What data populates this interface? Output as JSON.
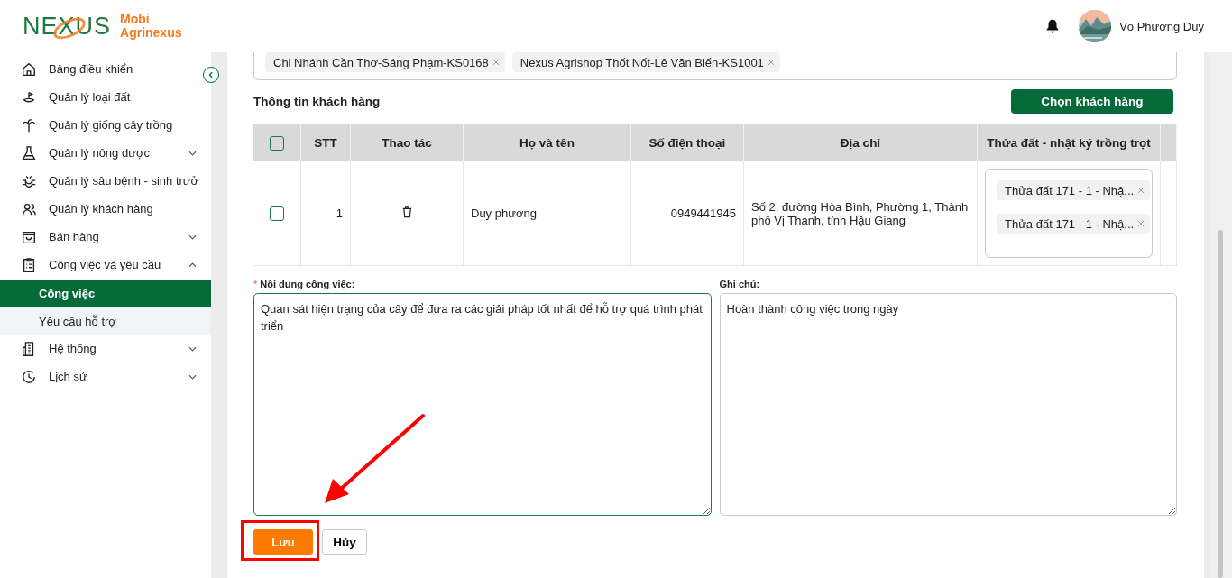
{
  "header": {
    "logo": {
      "wordmark": "NEXUS",
      "line1": "Mobi",
      "line2": "Agrinexus"
    },
    "user": {
      "name": "Võ Phương Duy"
    }
  },
  "sidebar": {
    "items": [
      {
        "label": "Bảng điều khiển"
      },
      {
        "label": "Quản lý loại đất"
      },
      {
        "label": "Quản lý giống cây trồng"
      },
      {
        "label": "Quản lý nông dược",
        "expanded": false
      },
      {
        "label": "Quản lý sâu bệnh - sinh trưở"
      },
      {
        "label": "Quản lý khách hàng"
      },
      {
        "label": "Bán hàng",
        "expanded": false
      },
      {
        "label": "Công việc và yêu cầu",
        "expanded": true,
        "children": [
          {
            "label": "Công việc",
            "selected": true
          },
          {
            "label": "Yêu cầu hỗ trợ",
            "selected": false
          }
        ]
      },
      {
        "label": "Hệ thống",
        "expanded": false
      },
      {
        "label": "Lịch sử",
        "expanded": false
      }
    ]
  },
  "stores_field": {
    "tags": [
      "Chi Nhánh Cần Thơ-Sáng Phạm-KS0168",
      "Nexus Agrishop Thốt Nốt-Lê  Văn Biến-KS1001"
    ]
  },
  "customers": {
    "title": "Thông tin khách hàng",
    "button": "Chọn khách hàng",
    "table": {
      "select_all": {
        "checked": false
      },
      "columns": [
        "STT",
        "Thao tác",
        "Họ và tên",
        "Số điện thoại",
        "Địa chỉ",
        "Thửa đất - nhật ký trồng trọt"
      ],
      "rows": [
        {
          "checked": false,
          "stt": "1",
          "name": "Duy phương",
          "phone": "0949441945",
          "address": "Số 2, đường Hòa Bình, Phường 1, Thành phố Vị Thanh, tỉnh Hậu Giang",
          "plots": [
            "Thửa đất 171 - 1 - Nhậ...",
            "Thửa đất 171 - 1 - Nhậ..."
          ]
        }
      ]
    }
  },
  "work_content": {
    "label": "Nội dung công việc:",
    "required_mark": "*",
    "value": "Quan sát hiện trạng của cây để đưa ra các giải pháp tốt nhất để hỗ trợ quá trình phát triển"
  },
  "note": {
    "label": "Ghi chú:",
    "value": "Hoàn thành công việc trong ngày"
  },
  "buttons": {
    "save": "Lưu",
    "cancel": "Hủy"
  }
}
